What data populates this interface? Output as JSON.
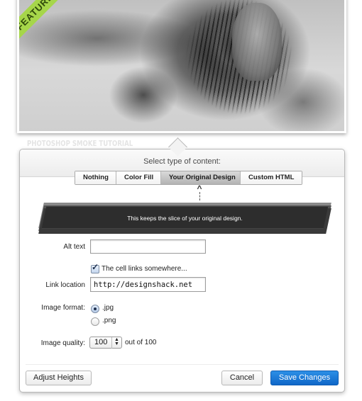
{
  "background": {
    "ribbon_label": "FEATURED",
    "caption": "PHOTOSHOP SMOKE TUTORIAL",
    "image_description": "black-and-white photo of a woman with flying hair and smoke"
  },
  "popover": {
    "title": "Select type of content:",
    "content_types": [
      {
        "label": "Nothing",
        "selected": false
      },
      {
        "label": "Color Fill",
        "selected": false
      },
      {
        "label": "Your Original Design",
        "selected": true
      },
      {
        "label": "Custom HTML",
        "selected": false
      }
    ],
    "pointer_icon": "up-arrow-dashed",
    "banner_text": "This keeps the slice of your original design.",
    "form": {
      "alt_text": {
        "label": "Alt text",
        "value": ""
      },
      "link_checkbox": {
        "label": "The cell links somewhere...",
        "checked": true
      },
      "link_location": {
        "label": "Link location",
        "value": "http://designshack.net"
      },
      "image_format": {
        "label": "Image format:",
        "options": [
          {
            "label": ".jpg",
            "selected": true
          },
          {
            "label": ".png",
            "selected": false
          }
        ]
      },
      "image_quality": {
        "label": "Image quality:",
        "value": "100",
        "suffix": "out of 100"
      }
    },
    "footer": {
      "adjust_heights": "Adjust Heights",
      "cancel": "Cancel",
      "save": "Save Changes"
    }
  },
  "colors": {
    "ribbon": "#a6d64a",
    "primary_button": "#1a77d6",
    "banner": "#2d2d2d"
  }
}
